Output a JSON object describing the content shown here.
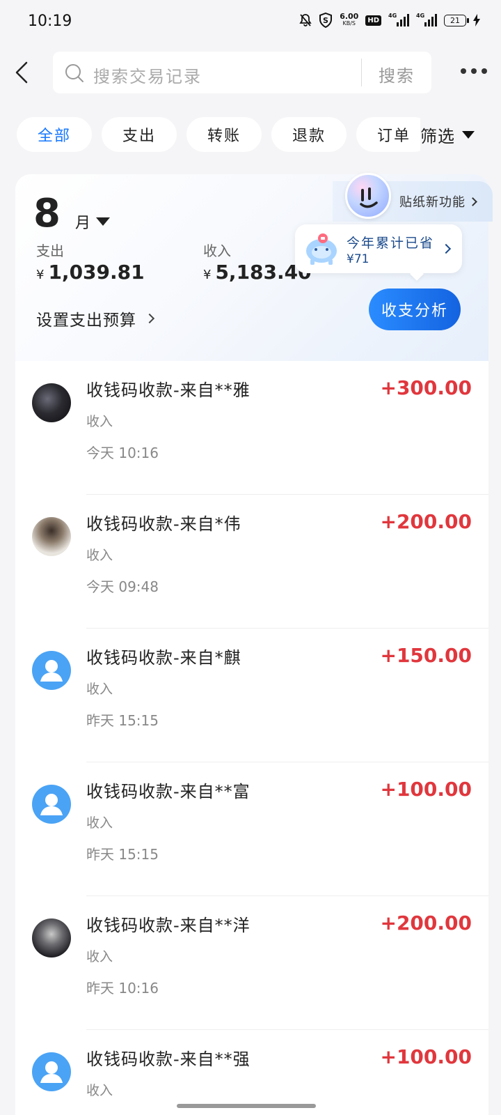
{
  "status_bar": {
    "time": "10:19",
    "speed_value": "6.00",
    "speed_unit": "KB/S",
    "hd": "HD",
    "net1": "4G",
    "net2": "4G",
    "battery": "21"
  },
  "search": {
    "placeholder": "搜索交易记录",
    "button": "搜索"
  },
  "tabs": [
    {
      "label": "全部",
      "active": true
    },
    {
      "label": "支出",
      "active": false
    },
    {
      "label": "转账",
      "active": false
    },
    {
      "label": "退款",
      "active": false
    },
    {
      "label": "订单",
      "active": false
    }
  ],
  "filter_label": "筛选",
  "summary": {
    "month": "8",
    "month_unit": "月",
    "expense_label": "支出",
    "expense_currency": "¥",
    "expense_value": "1,039.81",
    "income_label": "收入",
    "income_currency": "¥",
    "income_value": "5,183.40",
    "budget_label": "设置支出预算",
    "sticker_label": "贴纸新功能",
    "saved_title": "今年累计已省",
    "saved_value": "¥71",
    "analysis_button": "收支分析"
  },
  "transactions": [
    {
      "title": "收钱码收款-来自**雅",
      "type": "收入",
      "date": "今天 10:16",
      "amount": "+300.00",
      "avatar": "photo1"
    },
    {
      "title": "收钱码收款-来自*伟",
      "type": "收入",
      "date": "今天 09:48",
      "amount": "+200.00",
      "avatar": "photo2"
    },
    {
      "title": "收钱码收款-来自*麒",
      "type": "收入",
      "date": "昨天 15:15",
      "amount": "+150.00",
      "avatar": "default"
    },
    {
      "title": "收钱码收款-来自**富",
      "type": "收入",
      "date": "昨天 15:15",
      "amount": "+100.00",
      "avatar": "default"
    },
    {
      "title": "收钱码收款-来自**洋",
      "type": "收入",
      "date": "昨天 10:16",
      "amount": "+200.00",
      "avatar": "photo3"
    },
    {
      "title": "收钱码收款-来自**强",
      "type": "收入",
      "date": "",
      "amount": "+100.00",
      "avatar": "default"
    }
  ],
  "colors": {
    "accent": "#1677ff",
    "income_amount": "#e0373d",
    "default_avatar": "#4aa3f5"
  }
}
